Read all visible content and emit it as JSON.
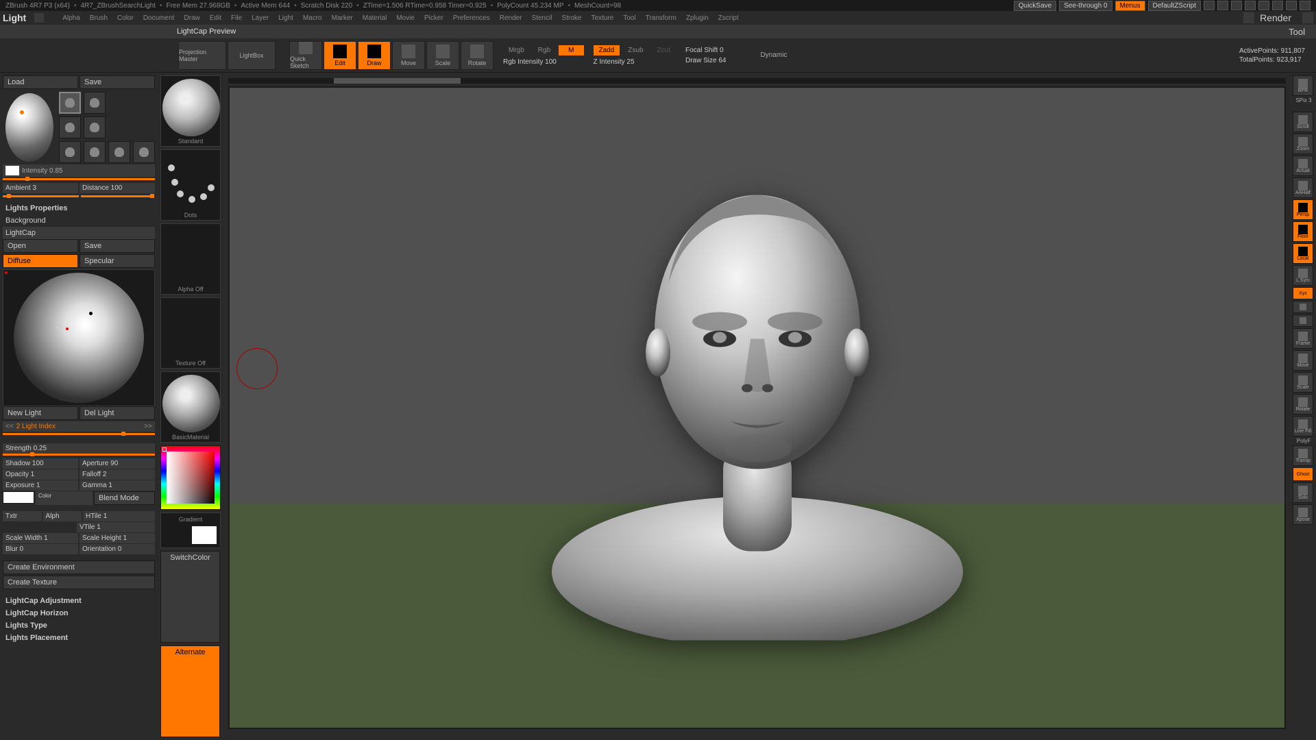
{
  "status": {
    "app": "ZBrush 4R7 P3 (x64)",
    "doc": "4R7_ZBrushSearchLight",
    "freemem": "Free Mem 27.968GB",
    "activemem": "Active Mem 644",
    "scratch": "Scratch Disk 220",
    "ztime": "ZTime=1.506 RTime=0.958 Timer=0.925",
    "polycount": "PolyCount 45.234 MP",
    "meshcount": "MeshCount=98",
    "quicksave": "QuickSave",
    "seethrough": "See-through  0",
    "menus": "Menus",
    "script": "DefaultZScript"
  },
  "panel_title": "Light",
  "menu": [
    "Alpha",
    "Brush",
    "Color",
    "Document",
    "Draw",
    "Edit",
    "File",
    "Layer",
    "Light",
    "Macro",
    "Marker",
    "Material",
    "Movie",
    "Picker",
    "Preferences",
    "Render",
    "Stencil",
    "Stroke",
    "Texture",
    "Tool",
    "Transform",
    "Zplugin",
    "Zscript"
  ],
  "render": "Render",
  "tool": "Tool",
  "header_preview": "LightCap Preview",
  "toolbar": {
    "projection": "Projection Master",
    "lightbox": "LightBox",
    "quicksketch": "Quick Sketch",
    "edit": "Edit",
    "draw": "Draw",
    "move": "Move",
    "scale": "Scale",
    "rotate": "Rotate",
    "mrgb": "Mrgb",
    "rgb": "Rgb",
    "m": "M",
    "rgb_intensity": "Rgb Intensity 100",
    "zadd": "Zadd",
    "zsub": "Zsub",
    "zcut": "Zcut",
    "z_intensity": "Z Intensity 25",
    "focal_shift": "Focal Shift 0",
    "draw_size": "Draw Size 64",
    "dynamic": "Dynamic",
    "activepoints": "ActivePoints: 911,807",
    "totalpoints": "TotalPoints: 923,917"
  },
  "left": {
    "load": "Load",
    "save": "Save",
    "intensity": "Intensity 0.85",
    "ambient": "Ambient 3",
    "distance": "Distance 100",
    "lights_properties": "Lights Properties",
    "background": "Background",
    "lightcap": "LightCap",
    "open": "Open",
    "save2": "Save",
    "diffuse": "Diffuse",
    "specular": "Specular",
    "new_light": "New Light",
    "del_light": "Del Light",
    "light_index": "2 Light Index",
    "strength": "Strength 0.25",
    "shadow": "Shadow 100",
    "aperture": "Aperture 90",
    "opacity": "Opacity 1",
    "falloff": "Falloff 2",
    "exposure": "Exposure 1",
    "gamma": "Gamma 1",
    "color": "Color",
    "blend": "Blend Mode",
    "txtr": "Txtr",
    "alph": "Alph",
    "htile": "HTile 1",
    "vtile": "VTile 1",
    "scale_width": "Scale Width 1",
    "scale_height": "Scale Height 1",
    "blur": "Blur 0",
    "orientation": "Orientation 0",
    "create_env": "Create Environment",
    "create_tex": "Create Texture",
    "lightcap_adj": "LightCap Adjustment",
    "lightcap_hor": "LightCap Horizon",
    "lights_type": "Lights Type",
    "lights_placement": "Lights Placement"
  },
  "tray": {
    "standard": "Standard",
    "dots": "Dots",
    "alpha_off": "Alpha Off",
    "texture_off": "Texture Off",
    "basicmaterial": "BasicMaterial",
    "gradient": "Gradient",
    "switchcolor": "SwitchColor",
    "alternate": "Alternate"
  },
  "right": {
    "bpr": "BPR",
    "spix": "SPix 3",
    "scroll": "Scroll",
    "zoom": "Zoom",
    "actual": "Actual",
    "aahalf": "AAHalf",
    "persp": "Persp",
    "floor": "Floor",
    "local": "Local",
    "lsym": "L.Sym",
    "xyz": "Xyz",
    "frame": "Frame",
    "move": "Move",
    "scale": "Scale",
    "rotate": "Rotate",
    "linefill": "Line Fill",
    "polyf": "PolyF",
    "transp": "Transp",
    "ghost": "Ghost",
    "solo": "Solo",
    "xpose": "Xpose"
  }
}
